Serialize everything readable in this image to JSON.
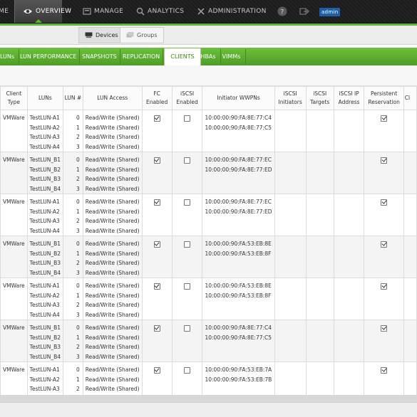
{
  "nav": {
    "home": "ME",
    "overview": "OVERVIEW",
    "manage": "MANAGE",
    "analytics": "ANALYTICS",
    "administration": "ADMINISTRATION",
    "user": "admin",
    "accent": "#5cb82e"
  },
  "subnav": {
    "devices": "Devices",
    "groups": "Groups"
  },
  "tabs": [
    "LUNs",
    "LUN PERFORMANCE",
    "SNAPSHOTS",
    "REPLICATION",
    "CLIENTS",
    "HBAs",
    "VIMMs"
  ],
  "active_tab": "CLIENTS",
  "table": {
    "headers": {
      "client_type": "Client Type",
      "luns": "LUNs",
      "lun_num": "LUN #",
      "lun_access": "LUN Access",
      "fc_enabled": "FC Enabled",
      "iscsi_enabled": "iSCSI Enabled",
      "wwpns": "Initiator WWPNs",
      "iscsi_initiators": "iSCSI Initiators",
      "iscsi_targets": "iSCSI Targets",
      "iscsi_ip": "iSCSI IP Address",
      "persistent_res": "Persistent Reservation",
      "cut": "Cl"
    },
    "access_value": "Read/Write (Shared)",
    "rows": [
      {
        "client_type": "VMWare",
        "luns": [
          "TestLUN-A1",
          "TestLUN-A2",
          "TestLUN-A3",
          "TestLUN-A4"
        ],
        "nums": [
          "0",
          "1",
          "2",
          "3"
        ],
        "fc": true,
        "iscsi": false,
        "wwpns": [
          "10:00:00:90:FA:8E:77:C4",
          "10:00:00:90:FA:8E:77:C5"
        ],
        "persistent": true
      },
      {
        "client_type": "VMWare",
        "luns": [
          "TestLUN_B1",
          "TestLUN_B2",
          "TestLUN_B3",
          "TestLUN_B4"
        ],
        "nums": [
          "0",
          "1",
          "2",
          "3"
        ],
        "fc": true,
        "iscsi": false,
        "wwpns": [
          "10:00:00:90:FA:8E:77:EC",
          "10:00:00:90:FA:8E:77:ED"
        ],
        "persistent": true
      },
      {
        "client_type": "VMWare",
        "luns": [
          "TestLUN-A1",
          "TestLUN-A2",
          "TestLUN-A3",
          "TestLUN-A4"
        ],
        "nums": [
          "0",
          "1",
          "2",
          "3"
        ],
        "fc": true,
        "iscsi": false,
        "wwpns": [
          "10:00:00:90:FA:8E:77:EC",
          "10:00:00:90:FA:8E:77:ED"
        ],
        "persistent": true
      },
      {
        "client_type": "VMWare",
        "luns": [
          "TestLUN_B1",
          "TestLUN_B2",
          "TestLUN_B3",
          "TestLUN_B4"
        ],
        "nums": [
          "0",
          "1",
          "2",
          "3"
        ],
        "fc": true,
        "iscsi": false,
        "wwpns": [
          "10:00:00:90:FA:53:EB:8E",
          "10:00:00:90:FA:53:EB:8F"
        ],
        "persistent": true
      },
      {
        "client_type": "VMWare",
        "luns": [
          "TestLUN-A1",
          "TestLUN-A2",
          "TestLUN-A3",
          "TestLUN-A4"
        ],
        "nums": [
          "0",
          "1",
          "2",
          "3"
        ],
        "fc": true,
        "iscsi": false,
        "wwpns": [
          "10:00:00:90:FA:53:EB:8E",
          "10:00:00:90:FA:53:EB:8F"
        ],
        "persistent": true
      },
      {
        "client_type": "VMWare",
        "luns": [
          "TestLUN_B1",
          "TestLUN_B2",
          "TestLUN_B3",
          "TestLUN_B4"
        ],
        "nums": [
          "0",
          "1",
          "2",
          "3"
        ],
        "fc": true,
        "iscsi": false,
        "wwpns": [
          "10:00:00:90:FA:8E:77:C4",
          "10:00:00:90:FA:8E:77:C5"
        ],
        "persistent": true
      },
      {
        "client_type": "VMWare",
        "luns": [
          "TestLUN-A1",
          "TestLUN-A2",
          "TestLUN-A3"
        ],
        "nums": [
          "0",
          "1",
          "2"
        ],
        "fc": true,
        "iscsi": false,
        "wwpns": [
          "10:00:00:90:FA:53:EB:7A",
          "10:00:00:90:FA:53:EB:7B"
        ],
        "persistent": true
      }
    ]
  }
}
